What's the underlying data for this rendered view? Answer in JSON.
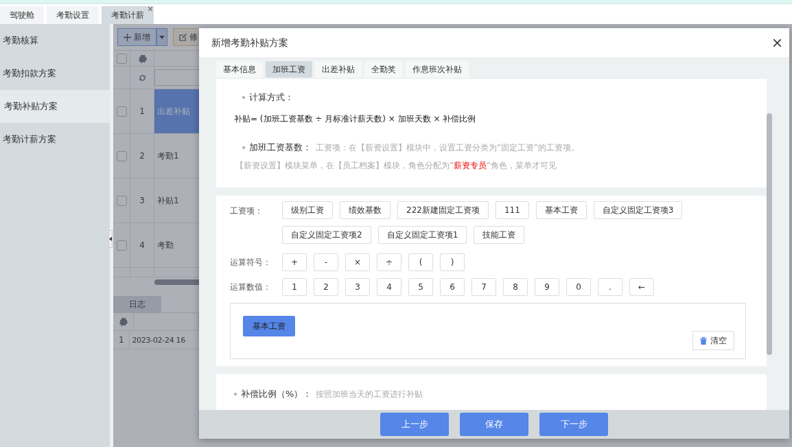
{
  "top_tabs": [
    {
      "label": "驾驶舱",
      "selected": false,
      "closable": false
    },
    {
      "label": "考勤设置",
      "selected": false,
      "closable": false
    },
    {
      "label": "考勤计薪",
      "selected": true,
      "closable": true
    }
  ],
  "sidebar": {
    "items": [
      {
        "label": "考勤核算",
        "selected": false
      },
      {
        "label": "考勤扣款方案",
        "selected": false
      },
      {
        "label": "考勤补贴方案",
        "selected": true
      },
      {
        "label": "考勤计薪方案",
        "selected": false
      }
    ]
  },
  "toolbar": {
    "buttons": [
      {
        "label": "新增",
        "kind": "add"
      },
      {
        "label": "修",
        "kind": "edit"
      }
    ]
  },
  "table": {
    "select_all_checked": false,
    "rows": [
      {
        "index": "1",
        "name": "出差补贴",
        "selected": true,
        "checked": false
      },
      {
        "index": "2",
        "name": "考勤1",
        "selected": false,
        "checked": false
      },
      {
        "index": "3",
        "name": "补贴1",
        "selected": false,
        "checked": false
      },
      {
        "index": "4",
        "name": "考勤",
        "selected": false,
        "checked": false
      }
    ]
  },
  "log": {
    "tab": "日志",
    "rows": [
      {
        "index": "1",
        "time": "2023-02-24 16"
      }
    ]
  },
  "dialog": {
    "title": "新增考勤补贴方案",
    "tabs": [
      {
        "label": "基本信息",
        "selected": false
      },
      {
        "label": "加班工资",
        "selected": true
      },
      {
        "label": "出差补贴",
        "selected": false
      },
      {
        "label": "全勤奖",
        "selected": false
      },
      {
        "label": "作息班次补贴",
        "selected": false
      }
    ],
    "formula": {
      "heading": "计算方式：",
      "text": "补贴= (加班工资基数 ÷ 月标准计薪天数) × 加班天数 × 补偿比例"
    },
    "base": {
      "heading": "加班工资基数：",
      "note": "工资项：在【薪资设置】模块中，设置工资分类为“固定工资”的工资项。",
      "note2": [
        {
          "text": "【薪资设置】模块菜单，在【员工档案】模块，角色分配为“",
          "highlight": false
        },
        {
          "text": "薪资专员",
          "highlight": true
        },
        {
          "text": "”角色，菜单才可见",
          "highlight": false
        }
      ]
    },
    "salary_items": {
      "label": "工资项：",
      "items": [
        "级别工资",
        "绩效基数",
        "222新建固定工资项",
        "111",
        "基本工资",
        "自定义固定工资项3",
        "自定义固定工资项2",
        "自定义固定工资项1",
        "技能工资"
      ]
    },
    "operators": {
      "label": "运算符号：",
      "keys": [
        "+",
        "-",
        "×",
        "÷",
        "(",
        ")"
      ]
    },
    "digits": {
      "label": "运算数值：",
      "keys": [
        "1",
        "2",
        "3",
        "4",
        "5",
        "6",
        "7",
        "8",
        "9",
        "0",
        ".",
        "←"
      ]
    },
    "expression": {
      "tokens": [
        "基本工资"
      ],
      "clear": "清空"
    },
    "ratio": {
      "heading": "补偿比例（%）：",
      "note": "按照加班当天的工资进行补贴"
    },
    "footer": {
      "buttons": [
        "上一步",
        "保存",
        "下一步"
      ]
    }
  }
}
